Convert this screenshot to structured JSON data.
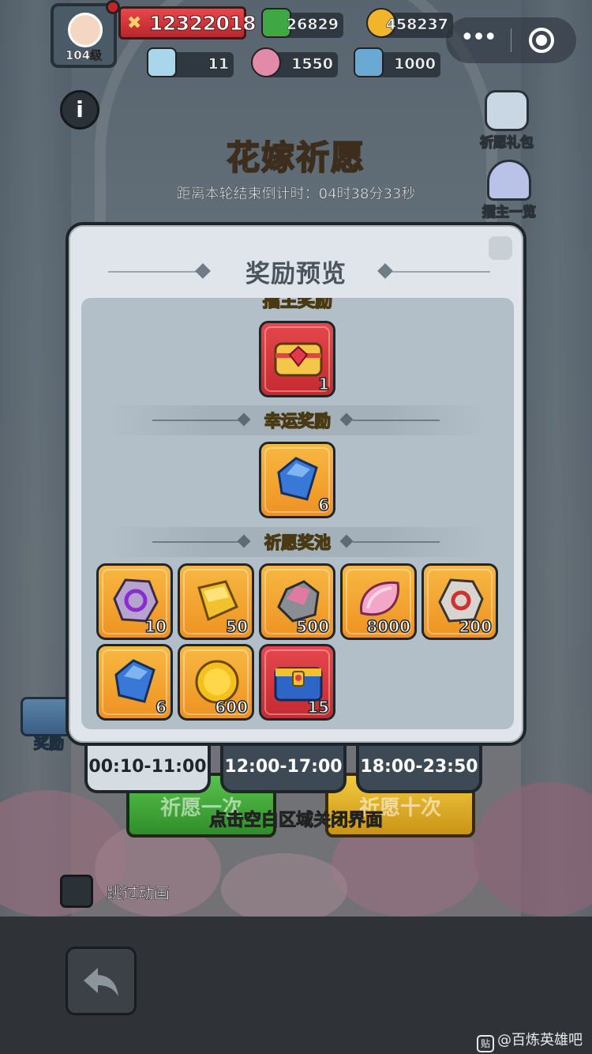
{
  "hud": {
    "player_level": "104级",
    "combat_power": "12322018",
    "resources": [
      {
        "icon": "green-gem-icon",
        "value": "26829"
      },
      {
        "icon": "gold-coin-icon",
        "value": "458237"
      },
      {
        "icon": "crystal-icon",
        "value": "11"
      },
      {
        "icon": "pink-petal-icon",
        "value": "1550"
      },
      {
        "icon": "blue-crate-icon",
        "value": "1000"
      }
    ]
  },
  "side_buttons": {
    "wish_gift": "祈愿礼包",
    "host_list": "擂主一览"
  },
  "event": {
    "title": "花嫁祈愿",
    "countdown": "距离本轮结束倒计时：04时38分33秒"
  },
  "modal": {
    "title": "奖励预览",
    "cut_heading": "擂主奖励",
    "top_item": {
      "icon": "ruby-treasure-chest-icon",
      "qty": "1",
      "bg": "red"
    },
    "lucky_section": "幸运奖励",
    "lucky_item": {
      "icon": "blue-gem-icon",
      "qty": "6",
      "bg": "orange"
    },
    "pool_section": "祈愿奖池",
    "pool_items": [
      {
        "icon": "purple-rune-stone-icon",
        "qty": "10",
        "bg": "orange"
      },
      {
        "icon": "gold-bar-icon",
        "qty": "50",
        "bg": "orange"
      },
      {
        "icon": "pink-ore-icon",
        "qty": "500",
        "bg": "orange"
      },
      {
        "icon": "pink-petal-icon",
        "qty": "8000",
        "bg": "orange"
      },
      {
        "icon": "red-rune-stone-icon",
        "qty": "200",
        "bg": "orange"
      },
      {
        "icon": "blue-gem-icon",
        "qty": "6",
        "bg": "orange"
      },
      {
        "icon": "gold-coin-icon",
        "qty": "600",
        "bg": "orange"
      },
      {
        "icon": "blue-treasure-chest-icon",
        "qty": "15",
        "bg": "red"
      }
    ]
  },
  "rewards_button": "奖励",
  "time_tabs": [
    "00:10-11:00",
    "12:00-17:00",
    "18:00-23:50"
  ],
  "wish_buttons": {
    "once": "祈愿一次",
    "ten": "祈愿十次"
  },
  "close_hint": "点击空白区域关闭界面",
  "skip_animation": "跳过动画",
  "watermark": "@百炼英雄吧",
  "colors": {
    "accent_gold": "#f3d35a",
    "item_orange": "#f0a030",
    "item_red": "#d63a40",
    "panel": "#dfe5ea"
  }
}
